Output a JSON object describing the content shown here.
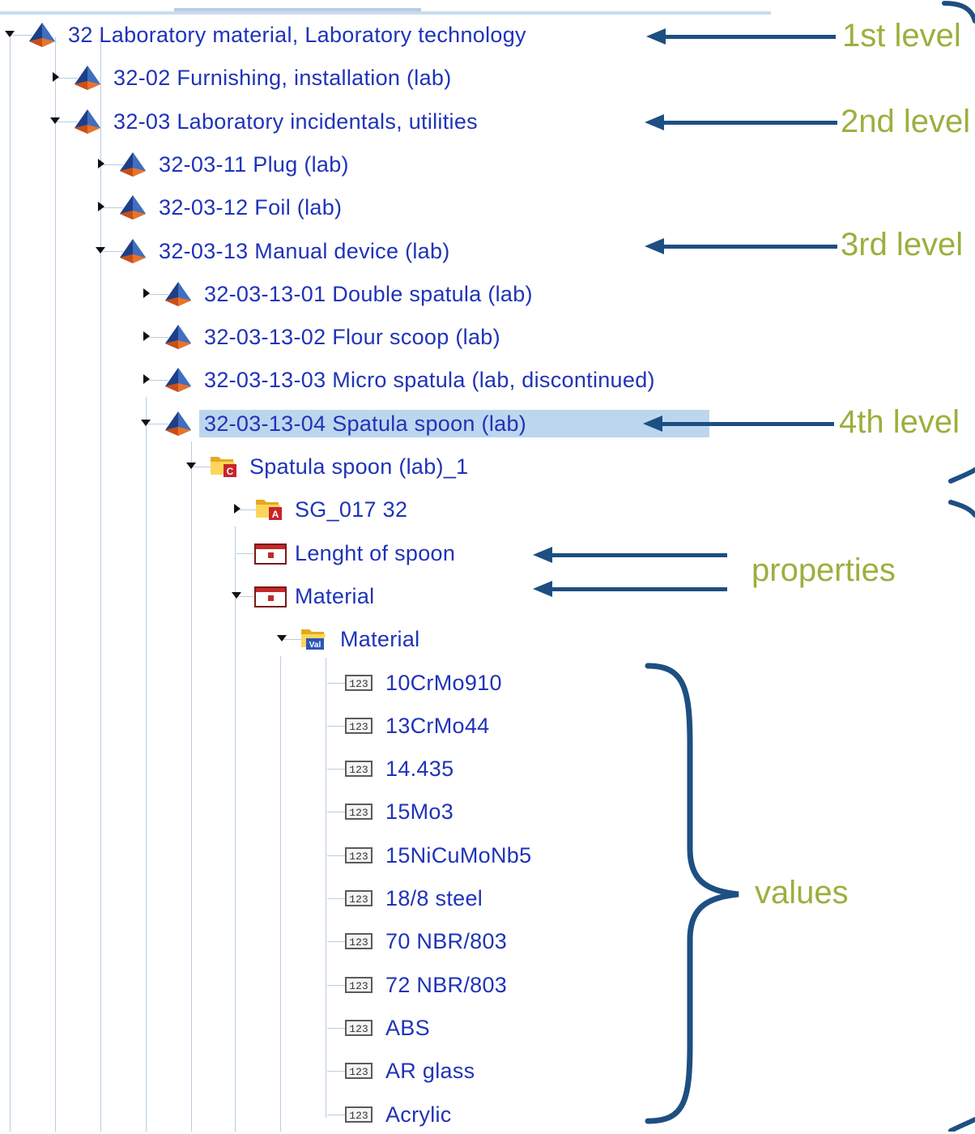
{
  "tree": {
    "items": [
      {
        "label": "32 Laboratory material, Laboratory technology",
        "level": 0,
        "state": "open",
        "icon": "pyramid-icon"
      },
      {
        "label": "32-02 Furnishing, installation (lab)",
        "level": 1,
        "state": "closed",
        "icon": "pyramid-icon"
      },
      {
        "label": "32-03 Laboratory incidentals, utilities",
        "level": 1,
        "state": "open",
        "icon": "pyramid-icon"
      },
      {
        "label": "32-03-11 Plug (lab)",
        "level": 2,
        "state": "closed",
        "icon": "pyramid-icon"
      },
      {
        "label": "32-03-12 Foil (lab)",
        "level": 2,
        "state": "closed",
        "icon": "pyramid-icon"
      },
      {
        "label": "32-03-13 Manual device (lab)",
        "level": 2,
        "state": "open",
        "icon": "pyramid-icon"
      },
      {
        "label": "32-03-13-01 Double spatula (lab)",
        "level": 3,
        "state": "closed",
        "icon": "pyramid-icon"
      },
      {
        "label": "32-03-13-02 Flour scoop (lab)",
        "level": 3,
        "state": "closed",
        "icon": "pyramid-icon"
      },
      {
        "label": "32-03-13-03 Micro spatula (lab, discontinued)",
        "level": 3,
        "state": "closed",
        "icon": "pyramid-icon"
      },
      {
        "label": "32-03-13-04 Spatula spoon (lab)",
        "level": 3,
        "state": "open",
        "icon": "pyramid-icon",
        "selected": true
      },
      {
        "label": "Spatula spoon (lab)_1",
        "level": 4,
        "state": "open",
        "icon": "folder-class-icon",
        "badge": "C"
      },
      {
        "label": "SG_017 32",
        "level": 5,
        "state": "closed",
        "icon": "folder-attribute-icon",
        "badge": "A"
      },
      {
        "label": "Lenght of spoon",
        "level": 5,
        "state": "none",
        "icon": "property-icon"
      },
      {
        "label": "Material",
        "level": 5,
        "state": "open",
        "icon": "property-icon"
      },
      {
        "label": "Material",
        "level": 6,
        "state": "open",
        "icon": "folder-value-icon",
        "badge": "Val"
      },
      {
        "label": "10CrMo910",
        "level": 7,
        "state": "none",
        "icon": "number-value-icon"
      },
      {
        "label": "13CrMo44",
        "level": 7,
        "state": "none",
        "icon": "number-value-icon"
      },
      {
        "label": "14.435",
        "level": 7,
        "state": "none",
        "icon": "number-value-icon"
      },
      {
        "label": "15Mo3",
        "level": 7,
        "state": "none",
        "icon": "number-value-icon"
      },
      {
        "label": "15NiCuMoNb5",
        "level": 7,
        "state": "none",
        "icon": "number-value-icon"
      },
      {
        "label": "18/8 steel",
        "level": 7,
        "state": "none",
        "icon": "number-value-icon"
      },
      {
        "label": "70 NBR/803",
        "level": 7,
        "state": "none",
        "icon": "number-value-icon"
      },
      {
        "label": "72 NBR/803",
        "level": 7,
        "state": "none",
        "icon": "number-value-icon"
      },
      {
        "label": "ABS",
        "level": 7,
        "state": "none",
        "icon": "number-value-icon"
      },
      {
        "label": "AR glass",
        "level": 7,
        "state": "none",
        "icon": "number-value-icon"
      },
      {
        "label": "Acrylic",
        "level": 7,
        "state": "none",
        "icon": "number-value-icon"
      }
    ],
    "number_icon_text": "123"
  },
  "annotations": {
    "level1": "1st level",
    "level2": "2nd level",
    "level3": "3rd level",
    "level4": "4th level",
    "properties": "properties",
    "values": "values"
  },
  "colors": {
    "label": "#1f33b8",
    "annotation_text": "#9caf3e",
    "annotation_arrow": "#1d4f82",
    "selection": "#bcd6ee"
  }
}
